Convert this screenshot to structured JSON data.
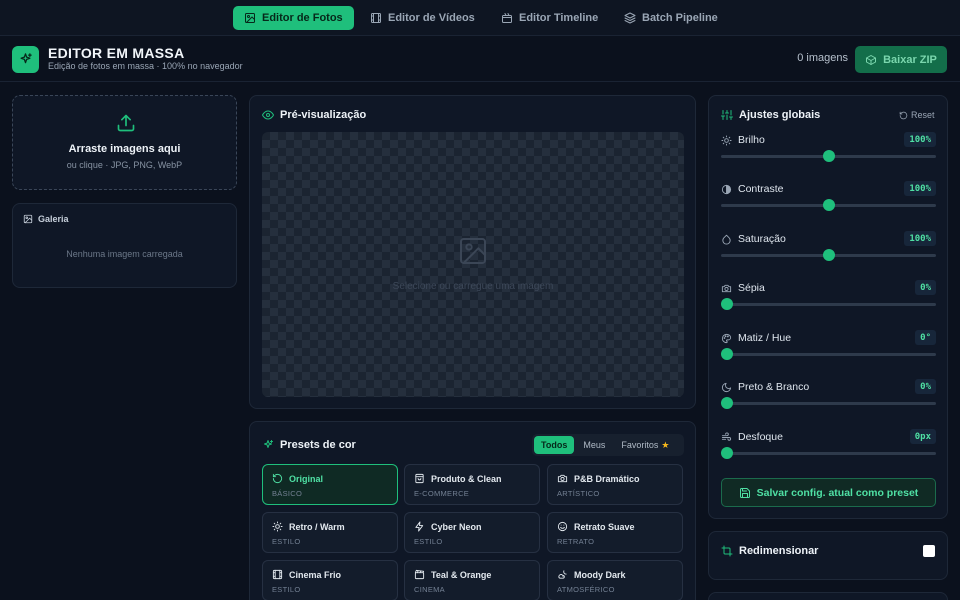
{
  "nav": {
    "tabs": [
      {
        "label": "Editor de Fotos",
        "icon": "image-icon",
        "active": true
      },
      {
        "label": "Editor de Vídeos",
        "icon": "film-icon",
        "active": false
      },
      {
        "label": "Editor Timeline",
        "icon": "timeline-icon",
        "active": false
      },
      {
        "label": "Batch Pipeline",
        "icon": "layers-icon",
        "active": false
      }
    ]
  },
  "header": {
    "title": "EDITOR EM MASSA",
    "subtitle": "Edição de fotos em massa · 100% no navegador",
    "image_count": "0 imagens",
    "zip_button": "Baixar ZIP"
  },
  "dropzone": {
    "title": "Arraste imagens aqui",
    "subtitle": "ou clique · JPG, PNG, WebP"
  },
  "gallery": {
    "title": "Galeria",
    "empty": "Nenhuma imagem carregada"
  },
  "preview": {
    "title": "Pré-visualização",
    "placeholder": "Selecione ou carregue uma imagem"
  },
  "presets": {
    "title": "Presets de cor",
    "filters": [
      {
        "label": "Todos",
        "active": true
      },
      {
        "label": "Meus",
        "active": false
      },
      {
        "label": "Favoritos",
        "active": false
      }
    ],
    "items": [
      {
        "name": "Original",
        "category": "BÁSICO",
        "icon": "rotate-ccw-icon",
        "selected": true
      },
      {
        "name": "Produto & Clean",
        "category": "E-COMMERCE",
        "icon": "shopping-bag-icon",
        "selected": false
      },
      {
        "name": "P&B Dramático",
        "category": "ARTÍSTICO",
        "icon": "camera-icon",
        "selected": false
      },
      {
        "name": "Retro / Warm",
        "category": "ESTILO",
        "icon": "sun-icon",
        "selected": false
      },
      {
        "name": "Cyber Neon",
        "category": "ESTILO",
        "icon": "zap-icon",
        "selected": false
      },
      {
        "name": "Retrato Suave",
        "category": "RETRATO",
        "icon": "smile-icon",
        "selected": false
      },
      {
        "name": "Cinema Frio",
        "category": "ESTILO",
        "icon": "film-icon",
        "selected": false
      },
      {
        "name": "Teal & Orange",
        "category": "CINEMA",
        "icon": "clapper-icon",
        "selected": false
      },
      {
        "name": "Moody Dark",
        "category": "ATMOSFÉRICO",
        "icon": "cloud-moon-icon",
        "selected": false
      }
    ]
  },
  "adjustments": {
    "title": "Ajustes globais",
    "reset": "Reset",
    "sliders": [
      {
        "label": "Brilho",
        "value": "100%",
        "icon": "sun-icon",
        "level": 0.5
      },
      {
        "label": "Contraste",
        "value": "100%",
        "icon": "contrast-icon",
        "level": 0.5
      },
      {
        "label": "Saturação",
        "value": "100%",
        "icon": "droplet-icon",
        "level": 0.5
      },
      {
        "label": "Sépia",
        "value": "0%",
        "icon": "camera-icon",
        "level": 0
      },
      {
        "label": "Matiz / Hue",
        "value": "0°",
        "icon": "palette-icon",
        "level": 0
      },
      {
        "label": "Preto & Branco",
        "value": "0%",
        "icon": "moon-icon",
        "level": 0
      },
      {
        "label": "Desfoque",
        "value": "0px",
        "icon": "wind-icon",
        "level": 0
      }
    ],
    "save_preset": "Salvar config. atual como preset"
  },
  "resize": {
    "title": "Redimensionar",
    "enabled": false
  },
  "colors": {
    "accent": "#1fbf7c",
    "background": "#0b111d",
    "card": "#0f1726"
  }
}
